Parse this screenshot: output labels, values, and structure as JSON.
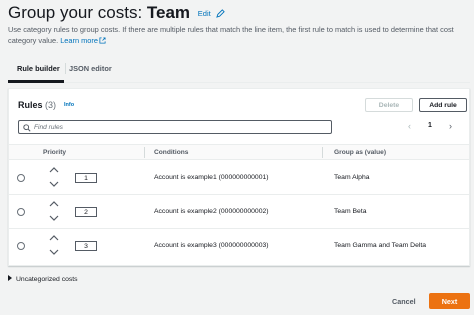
{
  "header": {
    "title_prefix": "Group your costs: ",
    "title_name": "Team",
    "edit_label": "Edit",
    "description": "Use category rules to group costs. If there are multiple rules that match the line item, the first rule to match is used to determine that cost category value.",
    "learn_more": "Learn more"
  },
  "tabs": [
    {
      "label": "Rule builder",
      "active": true
    },
    {
      "label": "JSON editor",
      "active": false
    }
  ],
  "rules": {
    "title": "Rules",
    "count": "(3)",
    "info": "Info",
    "delete_label": "Delete",
    "add_label": "Add rule",
    "search_placeholder": "Find rules",
    "page": "1",
    "columns": {
      "priority": "Priority",
      "conditions": "Conditions",
      "group": "Group as (value)"
    },
    "rows": [
      {
        "priority": "1",
        "cond_field": "Account",
        "cond_op": "is",
        "cond_value": "example1 (000000000001)",
        "group": "Team Alpha"
      },
      {
        "priority": "2",
        "cond_field": "Account",
        "cond_op": "is",
        "cond_value": "example2 (000000000002)",
        "group": "Team Beta"
      },
      {
        "priority": "3",
        "cond_field": "Account",
        "cond_op": "is",
        "cond_value": "example3 (000000000003)",
        "group": "Team Gamma and Team Delta"
      }
    ]
  },
  "uncategorized": "Uncategorized costs",
  "footer": {
    "cancel_label": "Cancel",
    "next_label": "Next"
  },
  "colors": {
    "link": "#0073bb",
    "primary": "#ec7211",
    "text": "#16191f"
  }
}
